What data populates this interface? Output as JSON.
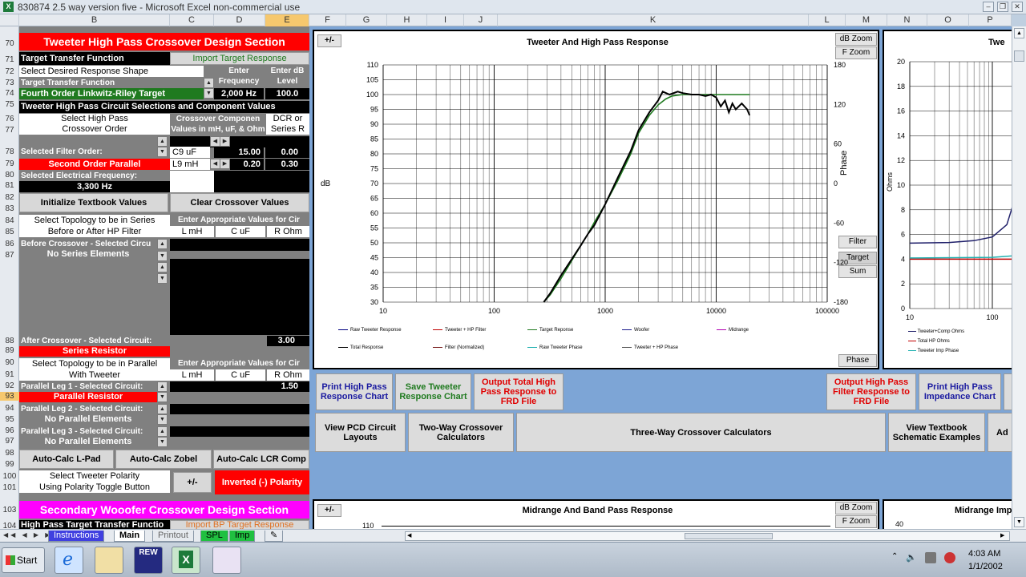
{
  "window": {
    "title": "830874 2.5 way version five - Microsoft Excel non-commercial use",
    "app_icon": "X"
  },
  "columns": [
    "B",
    "C",
    "D",
    "E",
    "F",
    "G",
    "H",
    "I",
    "J",
    "K",
    "L",
    "M",
    "N",
    "O",
    "P"
  ],
  "rows": [
    "70",
    "71",
    "72",
    "73",
    "74",
    "75",
    "76",
    "77",
    "78",
    "79",
    "80",
    "81",
    "82",
    "83",
    "84",
    "85",
    "86",
    "87",
    "88",
    "89",
    "90",
    "91",
    "92",
    "93",
    "94",
    "95",
    "96",
    "97",
    "98",
    "99",
    "100",
    "101",
    "103",
    "104"
  ],
  "left": {
    "section_title": "Tweeter High Pass Crossover Design Section",
    "target_transfer_function": "Target Transfer Function",
    "import_target": "Import Target Response",
    "select_shape": "Select Desired Response Shape",
    "target_tf_label": "Target Transfer Function",
    "enter_freq": "Enter Frequency",
    "enter_db": "Enter dB Level",
    "target_value": "Fourth Order Linkwitz-Riley Target",
    "freq_value": "2,000 Hz",
    "db_value": "100.0",
    "circuit_header": "Tweeter High Pass Circuit Selections and Component Values",
    "select_hp": "Select High Pass",
    "crossover_order": "Crossover Order",
    "comp_values_1": "Crossover Componen",
    "comp_values_2": "Values in mH, uF, & Ohm",
    "dcr_1": "DCR or",
    "dcr_2": "Series R",
    "selected_filter_order": "Selected Filter Order:",
    "c9": "C9  uF",
    "c9_val": "15.00",
    "c9_r": "0.00",
    "filter_order_value": "Second Order Parallel",
    "l9": "L9 mH",
    "l9_val": "0.20",
    "l9_r": "0.30",
    "selected_freq": "Selected Electrical Frequency:",
    "freq_sel_value": "3,300 Hz",
    "init_btn": "Initialize Textbook Values",
    "clear_btn": "Clear Crossover Values",
    "topology_series_1": "Select Topology to be in Series",
    "topology_series_2": "Before or After HP Filter",
    "enter_values_1": "Enter Appropriate Values for Cir",
    "col_l": "L mH",
    "col_c": "C uF",
    "col_r": "R Ohm",
    "before_crossover": "Before Crossover - Selected Circu",
    "no_series": "No Series Elements",
    "after_crossover": "After Crossover - Selected Circuit:",
    "after_val": "3.00",
    "series_resistor": "Series Resistor",
    "topology_parallel_1": "Select Topology to be in Parallel",
    "topology_parallel_2": "With Tweeter",
    "enter_values_2": "Enter Appropriate Values for Cir",
    "leg1": "Parallel Leg 1 - Selected Circuit:",
    "leg1_val": "1.50",
    "parallel_resistor": "Parallel Resistor",
    "leg2": "Parallel Leg 2 - Selected Circuit:",
    "no_parallel_2": "No Parallel Elements",
    "leg3": "Parallel Leg 3 - Selected Circuit:",
    "no_parallel_3": "No Parallel Elements",
    "lpad_btn": "Auto-Calc L-Pad",
    "zobel_btn": "Auto-Calc Zobel",
    "lcr_btn": "Auto-Calc LCR Comp",
    "polarity_1": "Select Tweeter Polarity",
    "polarity_2": "Using Polarity Toggle Button",
    "polarity_toggle": "+/-",
    "polarity_state": "Inverted (-) Polarity",
    "secondary_title": "Secondary Wooofer Crossover Design Section",
    "hp_target_tf": "High Pass Target Transfer Functio",
    "import_bp": "Import BP Target Response"
  },
  "chart_main": {
    "toggle": "+/-",
    "title": "Tweeter And High Pass Response",
    "db_zoom": "dB Zoom",
    "f_zoom": "F Zoom",
    "filter_btn": "Filter",
    "target_btn": "Target",
    "sum_btn": "Sum",
    "phase_btn": "Phase",
    "y_label": "dB",
    "y2_label": "Phase",
    "legend_row1": [
      "Raw Tweeter Response",
      "Tweeter + HP Filter",
      "Target Reponse",
      "Woofer",
      "Midrange"
    ],
    "legend_row2": [
      "Total Response",
      "Filter (Normalized)",
      "Raw Tweeter Phase",
      "Tweeter + HP Phase"
    ],
    "legend_colors": [
      "#000080",
      "#c00000",
      "#1f7a1f",
      "#1a1a8c",
      "#b000b0",
      "#000000",
      "#7a2020",
      "#20b0b0",
      "#555555"
    ]
  },
  "chart_data": [
    {
      "type": "line",
      "title": "Tweeter And High Pass Response",
      "xlabel": "",
      "ylabel": "dB",
      "y2label": "Phase",
      "xscale": "log",
      "xlim": [
        10,
        100000
      ],
      "ylim": [
        30,
        110
      ],
      "y2lim": [
        -180,
        180
      ],
      "xticks": [
        "10",
        "100",
        "1000",
        "10000",
        "100000"
      ],
      "yticks": [
        "30",
        "35",
        "40",
        "45",
        "50",
        "55",
        "60",
        "65",
        "70",
        "75",
        "80",
        "85",
        "90",
        "95",
        "100",
        "105",
        "110"
      ],
      "y2ticks": [
        "-180",
        "-120",
        "-60",
        "0",
        "60",
        "120",
        "180"
      ],
      "series": [
        {
          "name": "Total Response",
          "color": "#000000",
          "x": [
            280,
            320,
            400,
            500,
            600,
            700,
            800,
            1000,
            1300,
            1700,
            2000,
            2500,
            3000,
            3300,
            3800,
            4500,
            5000,
            6000,
            7000,
            8000,
            9000,
            10000,
            11000,
            12000,
            13000,
            14000,
            15000,
            17000,
            19000,
            20000
          ],
          "y": [
            30,
            33,
            39,
            44.5,
            49,
            53,
            56,
            63,
            72,
            81,
            88,
            94,
            98,
            101,
            100,
            101,
            100.5,
            100,
            100,
            99.5,
            100,
            99,
            96,
            98,
            94,
            97,
            95,
            97,
            95,
            93
          ]
        },
        {
          "name": "Target Reponse",
          "color": "#1f7a1f",
          "x": [
            280,
            320,
            400,
            500,
            600,
            700,
            800,
            1000,
            1300,
            1700,
            2000,
            2500,
            3000,
            3500,
            4000,
            5000,
            6000,
            8000,
            10000,
            15000,
            20000
          ],
          "y": [
            30,
            32.5,
            38,
            44,
            49,
            53,
            57,
            63,
            71,
            80,
            87,
            93,
            96.5,
            98.5,
            99.5,
            100,
            100,
            100,
            100,
            100,
            100
          ]
        }
      ]
    },
    {
      "type": "line",
      "title": "Twe",
      "ylabel": "Ohms",
      "xscale": "log",
      "xlim": [
        10,
        200
      ],
      "ylim": [
        0,
        20
      ],
      "yticks": [
        "0",
        "2",
        "4",
        "6",
        "8",
        "10",
        "12",
        "14",
        "16",
        "18",
        "20"
      ],
      "xticks": [
        "10",
        "100"
      ],
      "series": [
        {
          "name": "Tweeter+Comp Ohms",
          "color": "#20206a",
          "x": [
            10,
            30,
            60,
            100,
            150,
            200
          ],
          "y": [
            5.3,
            5.35,
            5.5,
            5.8,
            6.8,
            9.5
          ]
        },
        {
          "name": "Total HP Ohms",
          "color": "#c00000",
          "x": [
            10,
            200
          ],
          "y": [
            4.0,
            4.0
          ]
        },
        {
          "name": "Tweeter Imp Phase",
          "color": "#20b0b0",
          "x": [
            10,
            100,
            200
          ],
          "y": [
            4.1,
            4.15,
            4.3
          ]
        }
      ]
    }
  ],
  "right_chart": {
    "title": "Twe",
    "y_label": "Ohms",
    "legend": [
      "Tweeter+Comp Ohms",
      "Total HP Ohms",
      "Tweeter Imp Phase"
    ]
  },
  "buttons": {
    "print_hp": "Print High Pass Response Chart",
    "save_tweeter": "Save Tweeter Response Chart",
    "output_total": "Output Total High Pass Response to FRD  File",
    "output_filter": "Output High Pass Filter Response to FRD  File",
    "print_imp": "Print High Pass Impedance Chart",
    "view_pcd": "View PCD Circuit Layouts",
    "two_way": "Two-Way Crossover Calculators",
    "three_way": "Three-Way Crossover Calculators",
    "view_textbook": "View Textbook Schematic Examples",
    "ad": "Ad"
  },
  "lower": {
    "toggle": "+/-",
    "mid_title": "Midrange And Band Pass Response",
    "db_zoom": "dB Zoom",
    "f_zoom": "F Zoom",
    "y_top": "110",
    "imp_title": "Midrange Imp",
    "imp_y": "40"
  },
  "tabs": [
    "Instructions",
    "Main",
    "Printout",
    "SPL",
    "Imp"
  ],
  "taskbar": {
    "start": "Start",
    "time": "4:03 AM",
    "date": "1/1/2002",
    "rew": "REW"
  }
}
